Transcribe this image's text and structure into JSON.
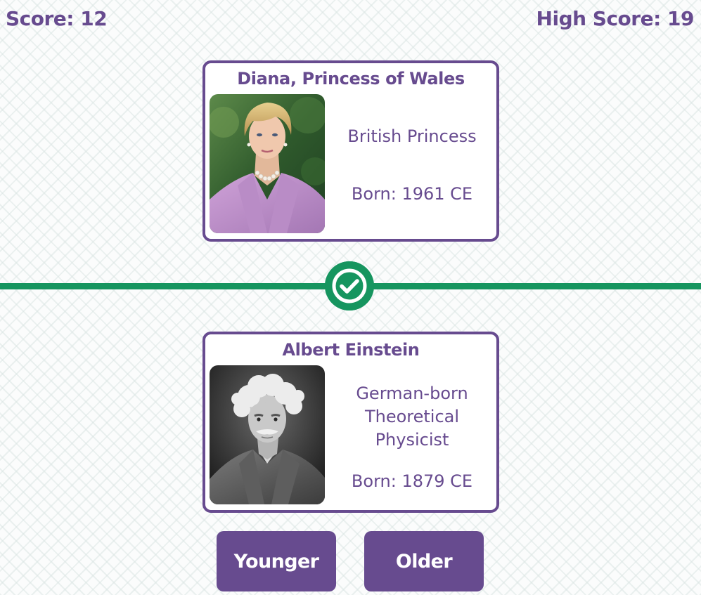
{
  "scores": {
    "score_label": "Score: 12",
    "high_score_label": "High Score: 19"
  },
  "previous_card": {
    "name": "Diana, Princess of Wales",
    "description": "British Princess",
    "born": "Born: 1961 CE",
    "portrait": "diana-portrait"
  },
  "current_card": {
    "name": "Albert Einstein",
    "description_lines": [
      "German-born",
      "Theoretical",
      "Physicist"
    ],
    "born": "Born: 1879 CE",
    "portrait": "einstein-portrait"
  },
  "result": {
    "status": "correct",
    "icon": "check-circle-icon",
    "color": "#16955f"
  },
  "buttons": {
    "younger_label": "Younger",
    "older_label": "Older"
  },
  "colors": {
    "accent": "#674b8f",
    "success": "#16955f"
  }
}
